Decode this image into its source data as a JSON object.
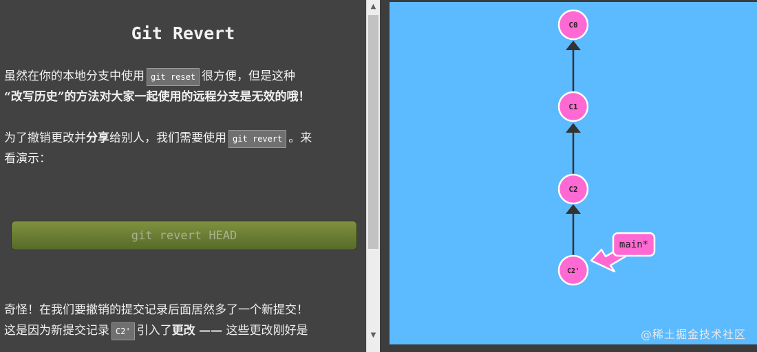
{
  "lesson": {
    "title": "Git Revert",
    "p1": {
      "t1": "虽然在你的本地分支中使用",
      "code1": "git reset",
      "t2": "很方便，但是这种",
      "t3": "“改写历史”的方法对大家一起使用的远程分支是无效的哦！"
    },
    "p2": {
      "t1": "为了撤销更改并",
      "bold1": "分享",
      "t2": "给别人，我们需要使用",
      "code1": "git revert",
      "t3": "。来",
      "t4": "看演示："
    },
    "command_button": "git revert HEAD",
    "p3": {
      "t1": "奇怪！在我们要撤销的提交记录后面居然多了一个新提交！",
      "t2": "这是因为新提交记录",
      "code1": "C2'",
      "t3": "引入了",
      "bold1": "更改",
      "t4": "——",
      "t5": "这些更改刚好是"
    }
  },
  "scrollbar": {
    "up_arrow": "▲",
    "down_arrow": "▼"
  },
  "visualization": {
    "background_color": "#5cbaff",
    "commit_color": "#ff69d4",
    "edge_color": "#333333",
    "commits": [
      {
        "id": "C0",
        "label": "C0"
      },
      {
        "id": "C1",
        "label": "C1"
      },
      {
        "id": "C2",
        "label": "C2"
      },
      {
        "id": "C2prime",
        "label": "C2'"
      }
    ],
    "branch": {
      "label": "main*",
      "target": "C2'"
    },
    "watermark": "@稀土掘金技术社区"
  }
}
